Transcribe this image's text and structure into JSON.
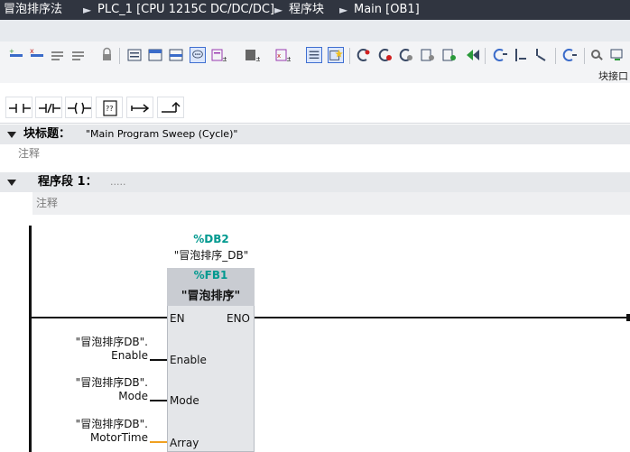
{
  "breadcrumb": {
    "project": "冒泡排序法",
    "device": "PLC_1 [CPU 1215C DC/DC/DC]",
    "folder": "程序块",
    "block": "Main [OB1]"
  },
  "toolbar": {
    "icons": [
      "insert-network-icon",
      "delete-network-icon",
      "toggle-absolute-icon",
      "toggle-symbolic-icon",
      "lock-icon",
      "show-all-icon",
      "show-comments-icon",
      "show-favorites-icon",
      "favorites-toggle-icon",
      "go-online-icon",
      "go-offline-icon",
      "snapshot-icon",
      "compare-icon",
      "show-bookmark-icon",
      "hide-bookmark-icon",
      "monitor-all-icon",
      "watch-table-icon",
      "call-hierarchy-icon",
      "goto-next-error-icon",
      "goto-prev-error-icon",
      "open-block-icon",
      "update-icon",
      "prev-bookmark-icon",
      "next-bookmark-icon",
      "settings-icon",
      "download-icon"
    ],
    "block_interface_label": "块接口"
  },
  "lad_palette": {
    "items": [
      "no-contact",
      "nc-contact",
      "coil",
      "empty-box",
      "open-branch",
      "close-branch"
    ]
  },
  "block_title": {
    "label": "块标题：",
    "value": "\"Main Program Sweep (Cycle)\"",
    "comment": "注释"
  },
  "network": {
    "label": "程序段 1：",
    "title_placeholder": ".....",
    "comment": "注释",
    "instance_db": "%DB2",
    "instance_db_name": "\"冒泡排序_DB\"",
    "fb_ref": "%FB1",
    "fb_name": "\"冒泡排序\"",
    "pins": {
      "en": "EN",
      "eno": "ENO",
      "enable": "Enable",
      "mode": "Mode",
      "array": "Array"
    },
    "operands": [
      {
        "db": "\"冒泡排序DB\".",
        "member": "Enable"
      },
      {
        "db": "\"冒泡排序DB\".",
        "member": "Mode"
      },
      {
        "db": "\"冒泡排序DB\".",
        "member": "MotorTime"
      }
    ],
    "colors": {
      "address": "#00998f",
      "array_wire": "#f0a020"
    }
  }
}
